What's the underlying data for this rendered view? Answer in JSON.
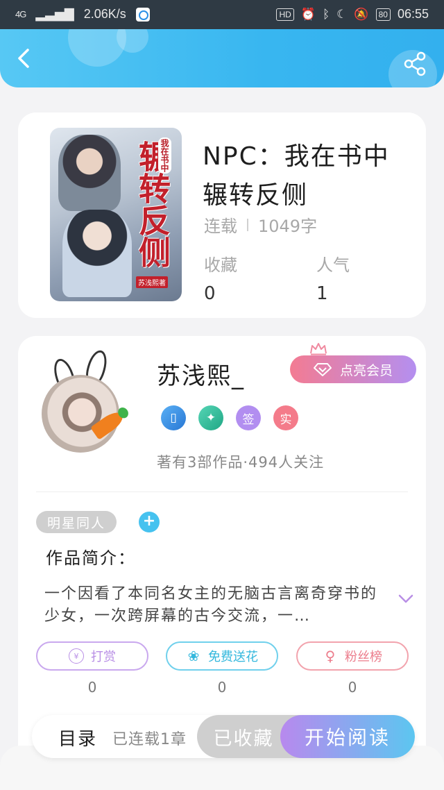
{
  "status_bar": {
    "network": "4G",
    "speed": "2.06K/s",
    "hd": "HD",
    "battery": "80",
    "time": "06:55"
  },
  "book": {
    "title": "NPC：我在书中辗转反侧",
    "cover_title": "辗转反侧",
    "cover_subtitle": "我在书中",
    "cover_author": "苏浅熙著",
    "status": "连载",
    "word_count": "1049字",
    "favorites_label": "收藏",
    "favorites_value": "0",
    "popularity_label": "人气",
    "popularity_value": "1"
  },
  "author": {
    "name": "苏浅熙_",
    "vip_button": "点亮会员",
    "badges": [
      "",
      "",
      "签",
      "实"
    ],
    "stats": "著有3部作品·494人关注"
  },
  "intro": {
    "tag": "明星同人",
    "add": "+",
    "title": "作品简介：",
    "text": "一个因看了本同名女主的无脑古言离奇穿书的少女，一次跨屏幕的古今交流，一…"
  },
  "actions": [
    {
      "label": "打赏",
      "icon": "¥",
      "value": "0",
      "color": "#b98fe6"
    },
    {
      "label": "免费送花",
      "icon": "❀",
      "value": "0",
      "color": "#4cc6e6"
    },
    {
      "label": "粉丝榜",
      "icon": "♀",
      "value": "0",
      "color": "#ef8b97"
    }
  ],
  "bottom": {
    "toc": "目录",
    "toc_status": "已连载1章",
    "collected": "已收藏",
    "start": "开始阅读"
  }
}
